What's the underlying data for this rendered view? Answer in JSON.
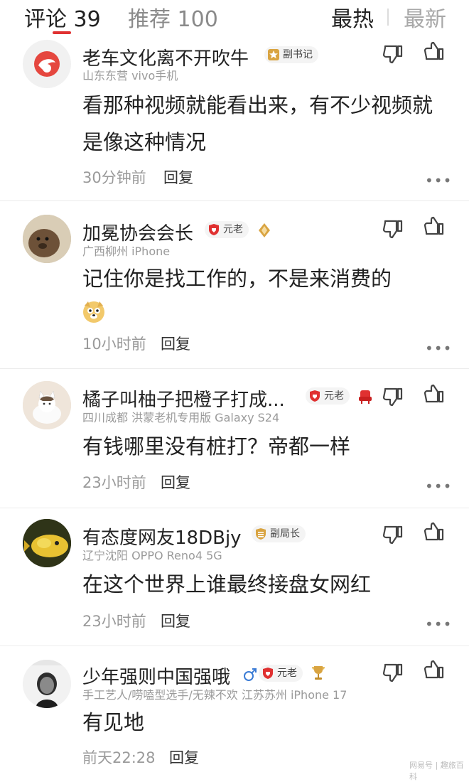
{
  "tabs": {
    "comments": "评论 39",
    "recommend": "推荐 100"
  },
  "sort": {
    "hot": "最热",
    "new": "最新"
  },
  "comments": [
    {
      "nickname": "老车文化离不开吹牛",
      "badge": "副书记",
      "meta": "山东东营  vivo手机",
      "text": "看那种视频就能看出来，有不少视频就是像这种情况",
      "time": "30分钟前",
      "reply": "回复"
    },
    {
      "nickname": "加冕协会会长",
      "badge": "元老",
      "meta": "广西柳州  iPhone",
      "text": "记住你是找工作的，不是来消费的",
      "time": "10小时前",
      "reply": "回复"
    },
    {
      "nickname": "橘子叫柚子把橙子打成...",
      "badge": "元老",
      "meta": "四川成都  洪蒙老机专用版  Galaxy S24",
      "text": "有钱哪里没有桩打？帝都一样",
      "time": "23小时前",
      "reply": "回复"
    },
    {
      "nickname": "有态度网友18DBjy",
      "badge": "副局长",
      "meta": "辽宁沈阳  OPPO Reno4 5G",
      "text": "在这个世界上谁最终接盘女网红",
      "time": "23小时前",
      "reply": "回复"
    },
    {
      "nickname": "少年强则中国强哦",
      "badge": "元老",
      "meta": "手工艺人/唠嗑型选手/无辣不欢  江苏苏州  iPhone 17",
      "text": "有见地",
      "time": "前天22:28",
      "reply": "回复"
    }
  ],
  "more_label": "•••",
  "watermark": "网易号 | 趣旅百科",
  "colors": {
    "accent": "#e03131",
    "badge_red": "#e03131",
    "badge_gold": "#d9a441"
  }
}
